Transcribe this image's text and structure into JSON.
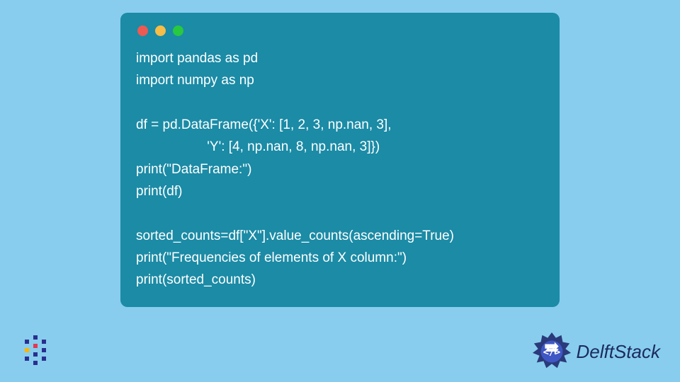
{
  "code": {
    "lines": [
      "import pandas as pd",
      "import numpy as np",
      "",
      "df = pd.DataFrame({'X': [1, 2, 3, np.nan, 3],",
      "                   'Y': [4, np.nan, 8, np.nan, 3]})",
      "print(\"DataFrame:\")",
      "print(df)",
      "",
      "sorted_counts=df[\"X\"].value_counts(ascending=True)",
      "print(\"Frequencies of elements of X column:\")",
      "print(sorted_counts)"
    ]
  },
  "window": {
    "dots": {
      "red": "#ec5a53",
      "yellow": "#f7bd46",
      "green": "#28c840"
    }
  },
  "brand": {
    "right_text": "DelftStack",
    "accent_color": "#1b2a5c"
  }
}
